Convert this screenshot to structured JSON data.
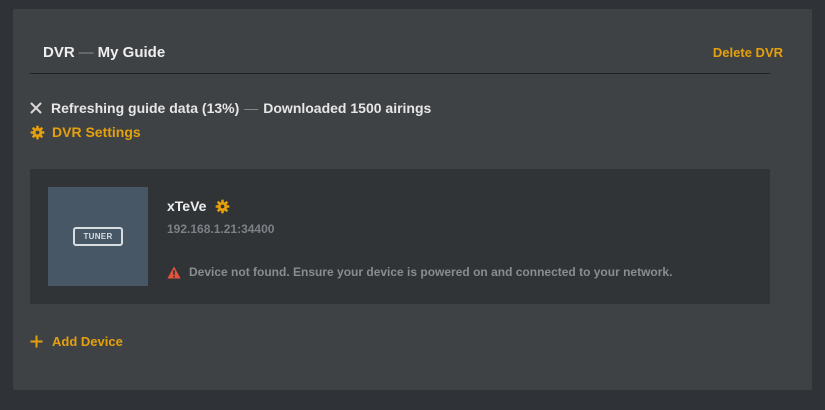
{
  "header": {
    "section": "DVR",
    "separator": "—",
    "title": "My Guide",
    "delete_label": "Delete DVR"
  },
  "status": {
    "text": "Refreshing guide data (13%)",
    "separator": "—",
    "detail": "Downloaded 1500 airings",
    "progress_percent": 13,
    "icon": "close-icon"
  },
  "settings": {
    "label": "DVR Settings",
    "icon": "gear-icon"
  },
  "device": {
    "thumbnail_label": "TUNER",
    "name": "xTeVe",
    "address": "192.168.1.21:34400",
    "error": "Device not found. Ensure your device is powered on and connected to your network.",
    "error_icon": "warning-icon",
    "settings_icon": "gear-icon"
  },
  "add_device": {
    "label": "Add Device",
    "icon": "plus-icon"
  },
  "colors": {
    "accent": "#e5a00d",
    "error": "#e5533c",
    "panel": "#3f4245",
    "card": "#313437",
    "thumbnail": "#475766"
  }
}
